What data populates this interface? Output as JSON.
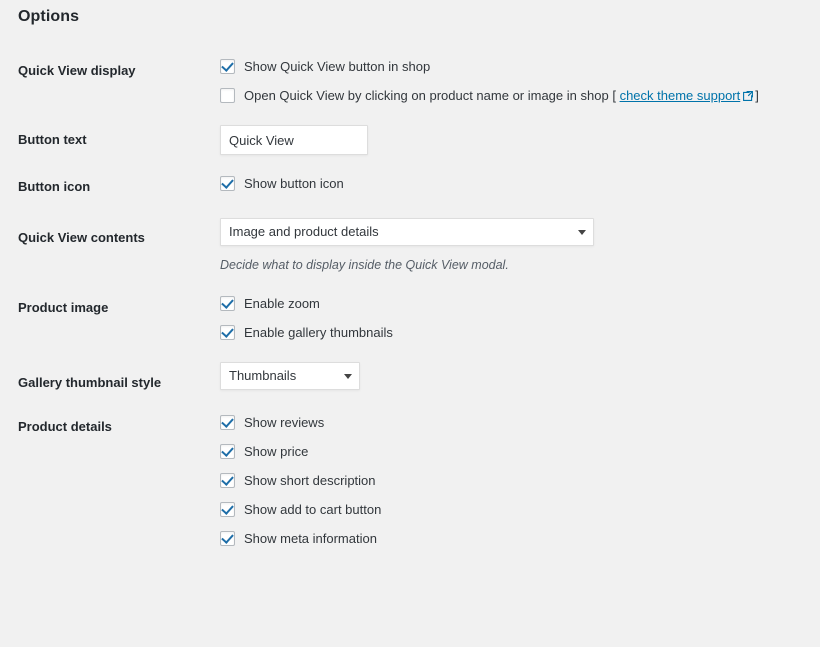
{
  "page": {
    "title": "Options"
  },
  "rows": {
    "quick_view_display": {
      "label": "Quick View display",
      "options": [
        {
          "label": "Show Quick View button in shop",
          "checked": true
        },
        {
          "label": "Open Quick View by clicking on product name or image in shop",
          "checked": false
        }
      ],
      "link": {
        "open_bracket": "[",
        "text": "check theme support",
        "icon": "external-link-icon",
        "close_bracket": "]"
      }
    },
    "button_text": {
      "label": "Button text",
      "value": "Quick View",
      "placeholder": ""
    },
    "button_icon": {
      "label": "Button icon",
      "options": [
        {
          "label": "Show button icon",
          "checked": true
        }
      ]
    },
    "quick_view_contents": {
      "label": "Quick View contents",
      "selected": "Image and product details",
      "helper": "Decide what to display inside the Quick View modal."
    },
    "product_image": {
      "label": "Product image",
      "options": [
        {
          "label": "Enable zoom",
          "checked": true
        },
        {
          "label": "Enable gallery thumbnails",
          "checked": true
        }
      ]
    },
    "gallery_thumbnail_style": {
      "label": "Gallery thumbnail style",
      "selected": "Thumbnails"
    },
    "product_details": {
      "label": "Product details",
      "options": [
        {
          "label": "Show reviews",
          "checked": true
        },
        {
          "label": "Show price",
          "checked": true
        },
        {
          "label": "Show short description",
          "checked": true
        },
        {
          "label": "Show add to cart button",
          "checked": true
        },
        {
          "label": "Show meta information",
          "checked": true
        }
      ]
    }
  },
  "colors": {
    "background": "#f1f1f1",
    "heading": "#23282d",
    "text": "#32373c",
    "link": "#0073aa",
    "checkmark": "#1e6ea8",
    "border": "#b4b9be"
  }
}
